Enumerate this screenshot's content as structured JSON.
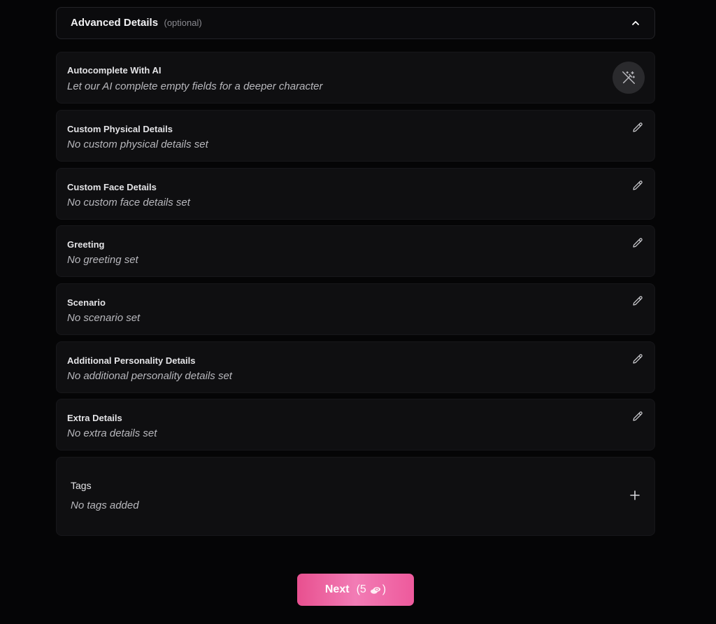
{
  "advanced": {
    "title": "Advanced Details",
    "optional": "(optional)",
    "toggle_icon": "chevron-up-icon"
  },
  "autocomplete": {
    "title": "Autocomplete With AI",
    "subtitle": "Let our AI complete empty fields for a deeper character",
    "icon": "magic-wand-icon"
  },
  "fields": [
    {
      "title": "Custom Physical Details",
      "subtitle": "No custom physical details set",
      "icon": "pencil-icon"
    },
    {
      "title": "Custom Face Details",
      "subtitle": "No custom face details set",
      "icon": "pencil-icon"
    },
    {
      "title": "Greeting",
      "subtitle": "No greeting set",
      "icon": "pencil-icon"
    },
    {
      "title": "Scenario",
      "subtitle": "No scenario set",
      "icon": "pencil-icon"
    },
    {
      "title": "Additional Personality Details",
      "subtitle": "No additional personality details set",
      "icon": "pencil-icon"
    },
    {
      "title": "Extra Details",
      "subtitle": "No extra details set",
      "icon": "pencil-icon"
    }
  ],
  "tags": {
    "title": "Tags",
    "empty": "No tags added",
    "icon": "plus-icon"
  },
  "next_button": {
    "label": "Next",
    "cost_open": "(5",
    "cost_close": ")",
    "coin_icon": "coins-icon"
  },
  "colors": {
    "background": "#050506",
    "card": "#0f0f11",
    "accent": "#ee5a9c"
  }
}
